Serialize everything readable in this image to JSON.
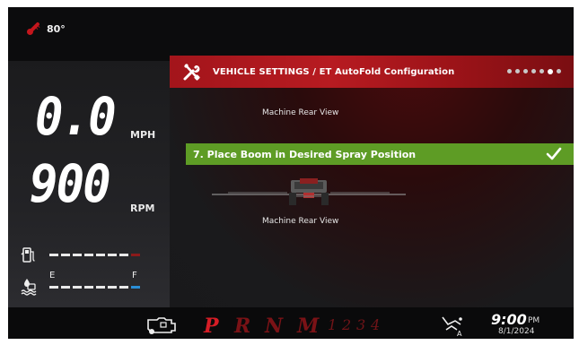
{
  "status": {
    "temperature": "80°"
  },
  "gauges": {
    "speed_value": "0.0",
    "speed_unit": "MPH",
    "rpm_value": "900",
    "rpm_unit": "RPM",
    "fuel_level_fraction": 0.95,
    "tank_empty_label": "E",
    "tank_full_label": "F"
  },
  "header": {
    "title": "VEHICLE SETTINGS / ET AutoFold Configuration",
    "page_dots_total": 7,
    "page_dots_active": 6
  },
  "main": {
    "top_view_label": "Machine Rear View",
    "step_text": "7. Place Boom in Desired Spray Position",
    "bottom_view_label": "Machine Rear View"
  },
  "transmission": {
    "gears": [
      "P",
      "R",
      "N",
      "M"
    ],
    "active_gear": "P",
    "gear_numbers": [
      "1",
      "2",
      "3",
      "4"
    ]
  },
  "clock": {
    "time": "9:00",
    "ampm": "PM",
    "date": "8/1/2024"
  },
  "colors": {
    "accent_red": "#b71b21",
    "step_green": "#5e9c25",
    "gauge_blue": "#2a8ed6"
  }
}
